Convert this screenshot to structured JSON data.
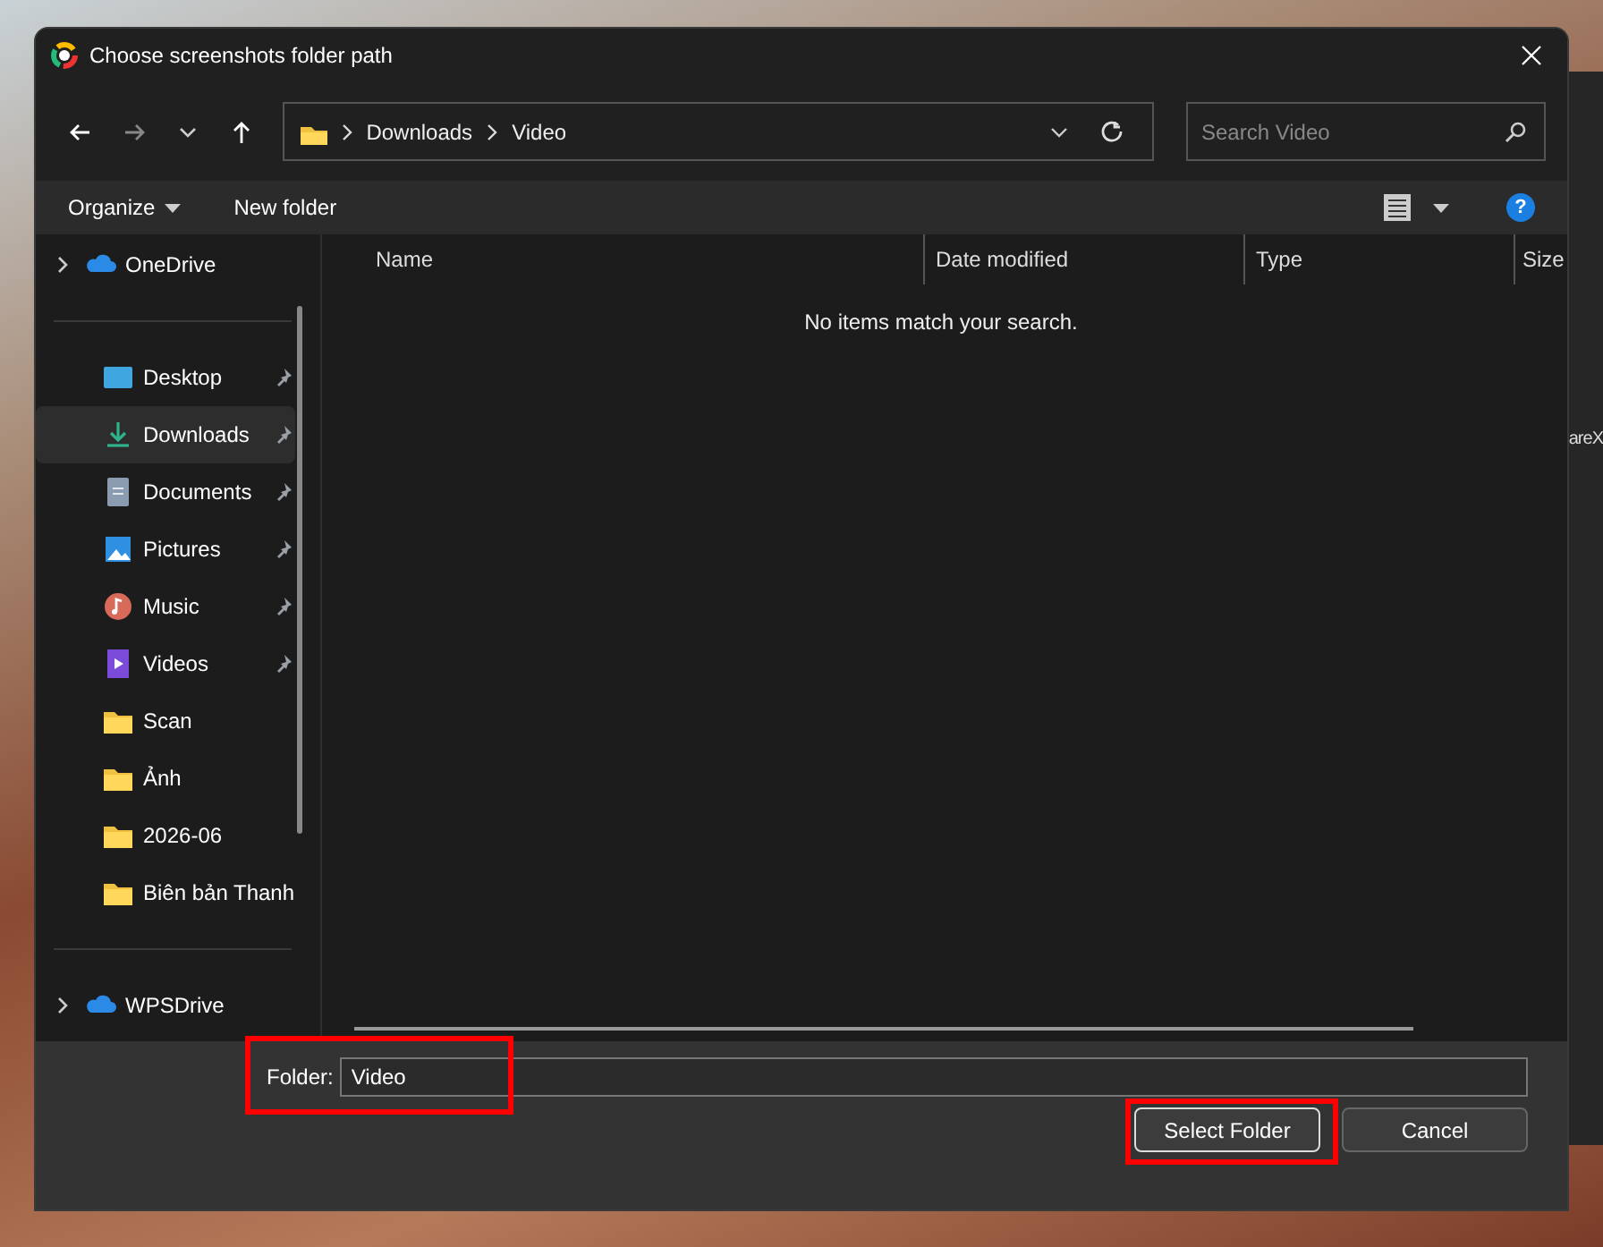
{
  "background_window": {
    "text": "areX"
  },
  "window": {
    "title": "Choose screenshots folder path"
  },
  "address_bar": {
    "segments": [
      "Downloads",
      "Video"
    ]
  },
  "search": {
    "placeholder": "Search Video"
  },
  "toolbar": {
    "organize": "Organize",
    "new_folder": "New folder",
    "help": "?"
  },
  "sidebar": {
    "groups": [
      [
        {
          "label": "OneDrive",
          "kind": "cloud",
          "pinned": false,
          "selected": false,
          "expandable": true
        }
      ],
      [
        {
          "label": "Desktop",
          "kind": "desktop",
          "pinned": true,
          "selected": false,
          "expandable": false
        },
        {
          "label": "Downloads",
          "kind": "download",
          "pinned": true,
          "selected": true,
          "expandable": false
        },
        {
          "label": "Documents",
          "kind": "document",
          "pinned": true,
          "selected": false,
          "expandable": false
        },
        {
          "label": "Pictures",
          "kind": "picture",
          "pinned": true,
          "selected": false,
          "expandable": false
        },
        {
          "label": "Music",
          "kind": "music",
          "pinned": true,
          "selected": false,
          "expandable": false
        },
        {
          "label": "Videos",
          "kind": "video",
          "pinned": true,
          "selected": false,
          "expandable": false
        },
        {
          "label": "Scan",
          "kind": "folder",
          "pinned": false,
          "selected": false,
          "expandable": false
        },
        {
          "label": "Ảnh",
          "kind": "folder",
          "pinned": false,
          "selected": false,
          "expandable": false
        },
        {
          "label": "2026-06",
          "kind": "folder",
          "pinned": false,
          "selected": false,
          "expandable": false
        },
        {
          "label": "Biên bản Thanh",
          "kind": "folder",
          "pinned": false,
          "selected": false,
          "expandable": false
        }
      ],
      [
        {
          "label": "WPSDrive",
          "kind": "cloud",
          "pinned": false,
          "selected": false,
          "expandable": true
        }
      ]
    ]
  },
  "table": {
    "columns": [
      "Name",
      "Date modified",
      "Type",
      "Size"
    ],
    "empty_message": "No items match your search."
  },
  "footer": {
    "folder_label": "Folder:",
    "folder_value": "Video",
    "folder_highlighted": true,
    "buttons": [
      {
        "label": "Select Folder",
        "default": true,
        "highlighted": true
      },
      {
        "label": "Cancel",
        "default": false,
        "highlighted": false
      }
    ]
  }
}
